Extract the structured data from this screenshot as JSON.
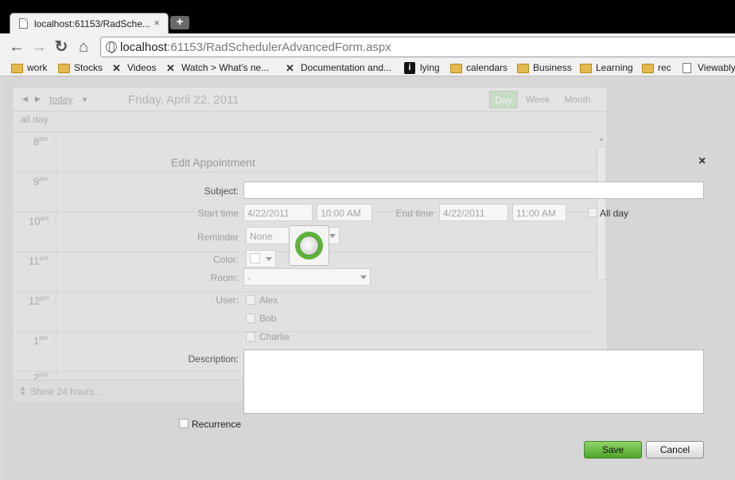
{
  "browser": {
    "tab_title": "localhost:61153/RadSche...",
    "tab_close": "×",
    "new_tab": "+",
    "url_host": "localhost",
    "url_rest": ":61153/RadSchedulerAdvancedForm.aspx",
    "nav": {
      "back": "←",
      "forward": "→",
      "reload": "↻",
      "home": "⌂"
    },
    "bookmarks": [
      {
        "label": "work",
        "icon": "folder-icon"
      },
      {
        "label": "Stocks",
        "icon": "folder-icon"
      },
      {
        "label": "Videos",
        "icon": "x-icon"
      },
      {
        "label": "Watch > What's ne...",
        "icon": "x-icon"
      },
      {
        "label": "Documentation and...",
        "icon": "x-icon"
      },
      {
        "label": "lying",
        "icon": "info-icon"
      },
      {
        "label": "calendars",
        "icon": "folder-icon"
      },
      {
        "label": "Business",
        "icon": "folder-icon"
      },
      {
        "label": "Learning",
        "icon": "folder-icon"
      },
      {
        "label": "rec",
        "icon": "folder-icon"
      },
      {
        "label": "Viewably",
        "icon": "page-icon"
      }
    ]
  },
  "scheduler": {
    "prev": "◀",
    "next": "▶",
    "today": "today",
    "date": "Friday, April 22, 2011",
    "views": {
      "day": "Day",
      "week": "Week",
      "month": "Month"
    },
    "all_day": "all day",
    "hours": [
      {
        "h": "8",
        "ampm": "am"
      },
      {
        "h": "9",
        "ampm": "am"
      },
      {
        "h": "10",
        "ampm": "am"
      },
      {
        "h": "11",
        "ampm": "am"
      },
      {
        "h": "12",
        "ampm": "pm"
      },
      {
        "h": "1",
        "ampm": "pm"
      },
      {
        "h": "2",
        "ampm": "pm"
      }
    ],
    "footer": "Show 24 hours..."
  },
  "form": {
    "title": "Edit Appointment",
    "close": "×",
    "subject_label": "Subject:",
    "subject_value": "",
    "start_label": "Start time",
    "start_date": "4/22/2011",
    "start_time": "10:00 AM",
    "end_label": "End time",
    "end_date": "4/22/2011",
    "end_time": "11:00 AM",
    "all_day_label": "All day",
    "reminder_label": "Reminder",
    "reminder_value": "None",
    "color_label": "Color:",
    "room_label": "Room:",
    "room_value": "-",
    "user_label": "User:",
    "users": [
      "Alex",
      "Bob",
      "Charlie"
    ],
    "description_label": "Description:",
    "description_value": "",
    "recurrence_label": "Recurrence",
    "save": "Save",
    "cancel": "Cancel"
  },
  "colors": {
    "save_green": "#5fb23a",
    "loading_ring": "#5fb23a"
  }
}
